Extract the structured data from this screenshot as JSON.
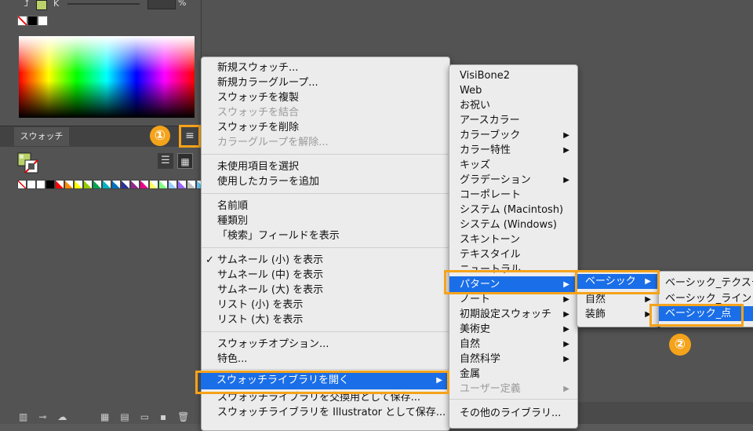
{
  "panel": {
    "k_label": "K",
    "percent_sign": "%",
    "tab_label": "スウォッチ",
    "menu_button_glyph": "≡",
    "list_view_glyph": "☰",
    "grid_view_glyph": "▦",
    "fill_color": "#b9d26a",
    "swatches": [
      "#ffffff",
      "#000000",
      "#ff0000",
      "#ff8a00",
      "#ffff00",
      "#99cc00",
      "#00a651",
      "#00b3c7",
      "#0072bc",
      "#2e3192",
      "#92278f",
      "#ec008c",
      "#ffff66",
      "#80ff80",
      "#99ccff",
      "#9966ff",
      "#c0c0c0",
      "#66ccff"
    ]
  },
  "annotations": {
    "step1": "①",
    "step2": "②"
  },
  "menu_main": {
    "items": [
      {
        "label": "新規スウォッチ...",
        "disabled": false
      },
      {
        "label": "新規カラーグループ...",
        "disabled": false
      },
      {
        "label": "スウォッチを複製",
        "disabled": false
      },
      {
        "label": "スウォッチを結合",
        "disabled": true
      },
      {
        "label": "スウォッチを削除",
        "disabled": false
      },
      {
        "label": "カラーグループを解除...",
        "disabled": true
      },
      {
        "label": "未使用項目を選択",
        "disabled": false
      },
      {
        "label": "使用したカラーを追加",
        "disabled": false
      },
      {
        "label": "名前順",
        "disabled": false
      },
      {
        "label": "種類別",
        "disabled": false
      },
      {
        "label": "「検索」フィールドを表示",
        "disabled": false
      },
      {
        "label": "サムネール (小) を表示",
        "disabled": false,
        "checked": true
      },
      {
        "label": "サムネール (中) を表示",
        "disabled": false
      },
      {
        "label": "サムネール (大) を表示",
        "disabled": false
      },
      {
        "label": "リスト (小) を表示",
        "disabled": false
      },
      {
        "label": "リスト (大) を表示",
        "disabled": false
      },
      {
        "label": "スウォッチオプション...",
        "disabled": false
      },
      {
        "label": "特色...",
        "disabled": false
      },
      {
        "label": "スウォッチライブラリを開く",
        "disabled": false,
        "selected": true
      },
      {
        "label": "スウォッチライブラリを交換用として保存...",
        "disabled": false
      },
      {
        "label": "スウォッチライブラリを Illustrator として保存...",
        "disabled": false
      }
    ]
  },
  "menu_library": {
    "items": [
      {
        "label": "VisiBone2"
      },
      {
        "label": "Web"
      },
      {
        "label": "お祝い"
      },
      {
        "label": "アースカラー"
      },
      {
        "label": "カラーブック"
      },
      {
        "label": "カラー特性"
      },
      {
        "label": "キッズ"
      },
      {
        "label": "グラデーション"
      },
      {
        "label": "コーポレート"
      },
      {
        "label": "システム (Macintosh)"
      },
      {
        "label": "システム (Windows)"
      },
      {
        "label": "スキントーン"
      },
      {
        "label": "テキスタイル"
      },
      {
        "label": "ニュートラル"
      },
      {
        "label": "パターン"
      },
      {
        "label": "ノート"
      },
      {
        "label": "初期設定スウォッチ"
      },
      {
        "label": "美術史"
      },
      {
        "label": "自然"
      },
      {
        "label": "自然科学"
      },
      {
        "label": "金属"
      },
      {
        "label": "ユーザー定義"
      },
      {
        "label": "その他のライブラリ..."
      }
    ]
  },
  "menu_pattern": {
    "items": [
      {
        "label": "ベーシック"
      },
      {
        "label": "自然"
      },
      {
        "label": "装飾"
      }
    ]
  },
  "menu_basic": {
    "items": [
      {
        "label": "ベーシック_テクスチャ"
      },
      {
        "label": "ベーシック_ライン"
      },
      {
        "label": "ベーシック_点"
      }
    ]
  },
  "submenu_arrow": "▶",
  "check_mark": "✓"
}
